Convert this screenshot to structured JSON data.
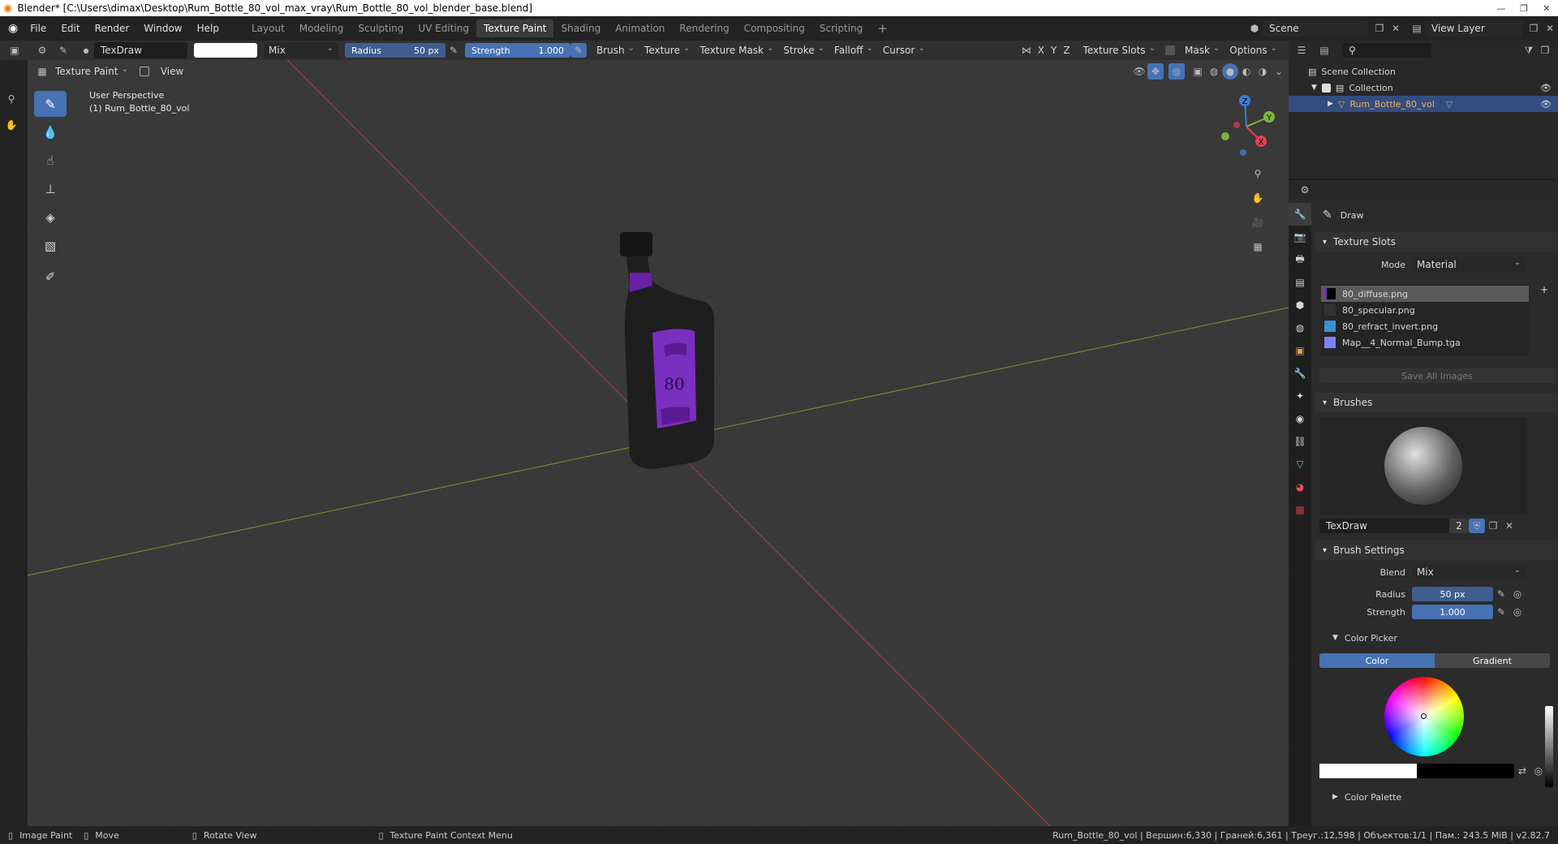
{
  "window": {
    "title": "Blender* [C:\\Users\\dimax\\Desktop\\Rum_Bottle_80_vol_max_vray\\Rum_Bottle_80_vol_blender_base.blend]"
  },
  "menu": {
    "items": [
      "File",
      "Edit",
      "Render",
      "Window",
      "Help"
    ]
  },
  "workspaces": {
    "tabs": [
      "Layout",
      "Modeling",
      "Sculpting",
      "UV Editing",
      "Texture Paint",
      "Shading",
      "Animation",
      "Rendering",
      "Compositing",
      "Scripting"
    ],
    "active": "Texture Paint",
    "add": "+"
  },
  "scene": {
    "name": "Scene",
    "view_layer": "View Layer"
  },
  "tool_header": {
    "brush_name": "TexDraw",
    "blend": "Mix",
    "radius_label": "Radius",
    "radius_value": "50 px",
    "strength_label": "Strength",
    "strength_value": "1.000",
    "menus": [
      "Brush",
      "Texture",
      "Texture Mask",
      "Stroke",
      "Falloff",
      "Cursor"
    ],
    "axes": [
      "X",
      "Y",
      "Z"
    ],
    "texture_slots": "Texture Slots",
    "mask": "Mask",
    "options": "Options"
  },
  "view_header": {
    "mode": "Texture Paint",
    "view": "View"
  },
  "viewport": {
    "perspective": "User Perspective",
    "object": "(1) Rum_Bottle_80_vol",
    "label_number": "80"
  },
  "gizmo": {
    "z": "Z",
    "y": "Y",
    "x": "X"
  },
  "outliner": {
    "root": "Scene Collection",
    "collection": "Collection",
    "object": "Rum_Bottle_80_vol"
  },
  "properties": {
    "tool_name": "Draw",
    "texture_slots": {
      "title": "Texture Slots",
      "mode_label": "Mode",
      "mode_value": "Material",
      "slots": [
        "80_diffuse.png",
        "80_specular.png",
        "80_refract_invert.png",
        "Map__4_Normal_Bump.tga"
      ],
      "save_all": "Save All Images"
    },
    "brushes": {
      "title": "Brushes",
      "name": "TexDraw",
      "users": "2"
    },
    "brush_settings": {
      "title": "Brush Settings",
      "blend_label": "Blend",
      "blend_value": "Mix",
      "radius_label": "Radius",
      "radius_value": "50 px",
      "strength_label": "Strength",
      "strength_value": "1.000"
    },
    "color_picker": {
      "title": "Color Picker",
      "tab_color": "Color",
      "tab_gradient": "Gradient"
    },
    "color_palette": {
      "title": "Color Palette"
    }
  },
  "statusbar": {
    "image_paint": "Image Paint",
    "move": "Move",
    "rotate": "Rotate View",
    "context": "Texture Paint Context Menu",
    "stats": "Rum_Bottle_80_vol | Вершин:6,330 | Граней:6,361 | Треуг.:12,598 | Объектов:1/1 | Пам.: 243.5 MiB | v2.82.7"
  },
  "colors": {
    "accent": "#4772b3",
    "selected_row": "#334d80",
    "bottle_label": "#7a2fc0"
  }
}
